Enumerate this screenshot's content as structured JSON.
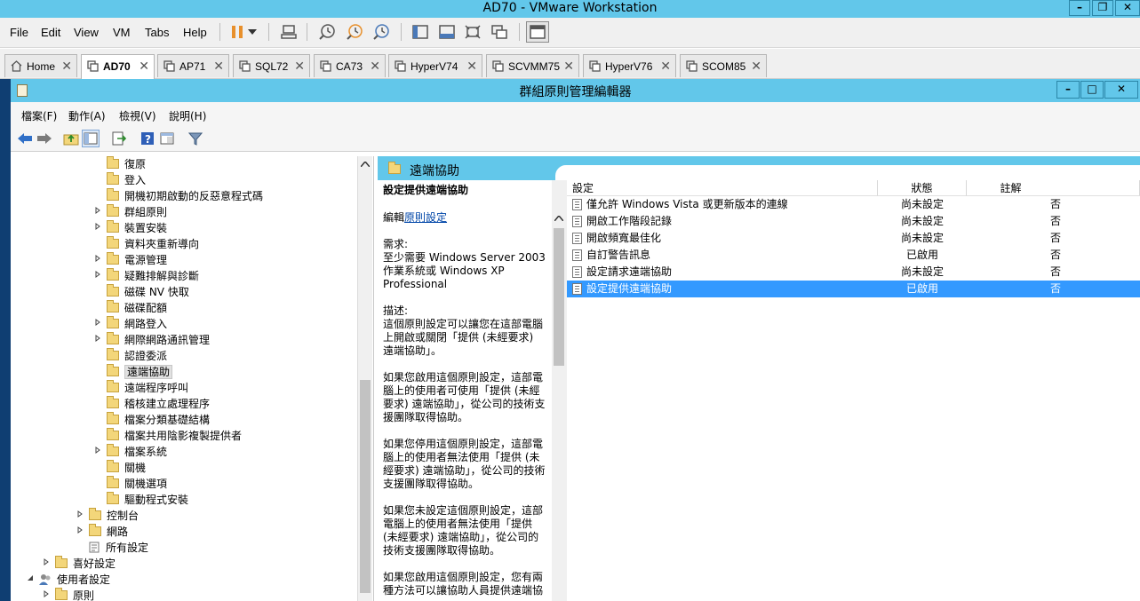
{
  "vmware": {
    "title": "AD70 - VMware Workstation",
    "menu": [
      "File",
      "Edit",
      "View",
      "VM",
      "Tabs",
      "Help"
    ],
    "tabs": [
      {
        "label": "Home",
        "active": false
      },
      {
        "label": "AD70",
        "active": true
      },
      {
        "label": "AP71",
        "active": false
      },
      {
        "label": "SQL72",
        "active": false
      },
      {
        "label": "CA73",
        "active": false
      },
      {
        "label": "HyperV74",
        "active": false
      },
      {
        "label": "SCVMM75",
        "active": false
      },
      {
        "label": "HyperV76",
        "active": false
      },
      {
        "label": "SCOM85",
        "active": false
      }
    ],
    "tab_close": "✕"
  },
  "gpe": {
    "title": "群組原則管理編輯器",
    "menu": [
      "檔案(F)",
      "動作(A)",
      "檢視(V)",
      "說明(H)"
    ]
  },
  "tree": [
    {
      "label": "復原",
      "level": 3,
      "expandable": false
    },
    {
      "label": "登入",
      "level": 3,
      "expandable": false
    },
    {
      "label": "開機初期啟動的反惡意程式碼",
      "level": 3,
      "expandable": false
    },
    {
      "label": "群組原則",
      "level": 3,
      "expandable": true
    },
    {
      "label": "裝置安裝",
      "level": 3,
      "expandable": true
    },
    {
      "label": "資料夾重新導向",
      "level": 3,
      "expandable": false
    },
    {
      "label": "電源管理",
      "level": 3,
      "expandable": true
    },
    {
      "label": "疑難排解與診斷",
      "level": 3,
      "expandable": true
    },
    {
      "label": "磁碟 NV 快取",
      "level": 3,
      "expandable": false
    },
    {
      "label": "磁碟配額",
      "level": 3,
      "expandable": false
    },
    {
      "label": "網路登入",
      "level": 3,
      "expandable": true
    },
    {
      "label": "網際網路通訊管理",
      "level": 3,
      "expandable": true
    },
    {
      "label": "認證委派",
      "level": 3,
      "expandable": false
    },
    {
      "label": "遠端協助",
      "level": 3,
      "expandable": false,
      "selected": true
    },
    {
      "label": "遠端程序呼叫",
      "level": 3,
      "expandable": false
    },
    {
      "label": "稽核建立處理程序",
      "level": 3,
      "expandable": false
    },
    {
      "label": "檔案分類基礎結構",
      "level": 3,
      "expandable": false
    },
    {
      "label": "檔案共用陰影複製提供者",
      "level": 3,
      "expandable": false
    },
    {
      "label": "檔案系統",
      "level": 3,
      "expandable": true
    },
    {
      "label": "關機",
      "level": 3,
      "expandable": false
    },
    {
      "label": "關機選項",
      "level": 3,
      "expandable": false
    },
    {
      "label": "驅動程式安裝",
      "level": 3,
      "expandable": false
    },
    {
      "label": "控制台",
      "level": 2,
      "expandable": true
    },
    {
      "label": "網路",
      "level": 2,
      "expandable": true
    },
    {
      "label": "所有設定",
      "level": 2,
      "expandable": false,
      "icon": "settings-list-icon"
    },
    {
      "label": "喜好設定",
      "level": 1,
      "expandable": true
    },
    {
      "label": "使用者設定",
      "level": 0,
      "expandable": true,
      "expanded": true,
      "icon": "users-icon"
    },
    {
      "label": "原則",
      "level": 1,
      "expandable": true
    }
  ],
  "right": {
    "header": "遠端協助",
    "description": {
      "title": "設定提供遠端協助",
      "edit_prefix": "編輯",
      "edit_link": "原則設定",
      "requirements_label": "需求:",
      "requirements": "至少需要 Windows Server 2003 作業系統或 Windows XP Professional",
      "desc_label": "描述:",
      "paragraphs": [
        "這個原則設定可以讓您在這部電腦上開啟或關閉「提供 (未經要求) 遠端協助」。",
        "如果您啟用這個原則設定，這部電腦上的使用者可使用「提供 (未經要求) 遠端協助」，從公司的技術支援團隊取得協助。",
        "如果您停用這個原則設定，這部電腦上的使用者無法使用「提供 (未經要求) 遠端協助」，從公司的技術支援團隊取得協助。",
        "如果您未設定這個原則設定，這部電腦上的使用者無法使用「提供 (未經要求) 遠端協助」，從公司的技術支援團隊取得協助。",
        "如果您啟用這個原則設定，您有兩種方法可以讓協助人員提供遠端協"
      ]
    },
    "columns": [
      "設定",
      "狀態",
      "註解"
    ],
    "rows": [
      {
        "name": "僅允許 Windows Vista 或更新版本的連線",
        "state": "尚未設定",
        "note": "否"
      },
      {
        "name": "開啟工作階段記錄",
        "state": "尚未設定",
        "note": "否"
      },
      {
        "name": "開啟頻寬最佳化",
        "state": "尚未設定",
        "note": "否"
      },
      {
        "name": "自訂警告訊息",
        "state": "已啟用",
        "note": "否"
      },
      {
        "name": "設定請求遠端協助",
        "state": "尚未設定",
        "note": "否"
      },
      {
        "name": "設定提供遠端協助",
        "state": "已啟用",
        "note": "否",
        "selected": true
      }
    ]
  }
}
